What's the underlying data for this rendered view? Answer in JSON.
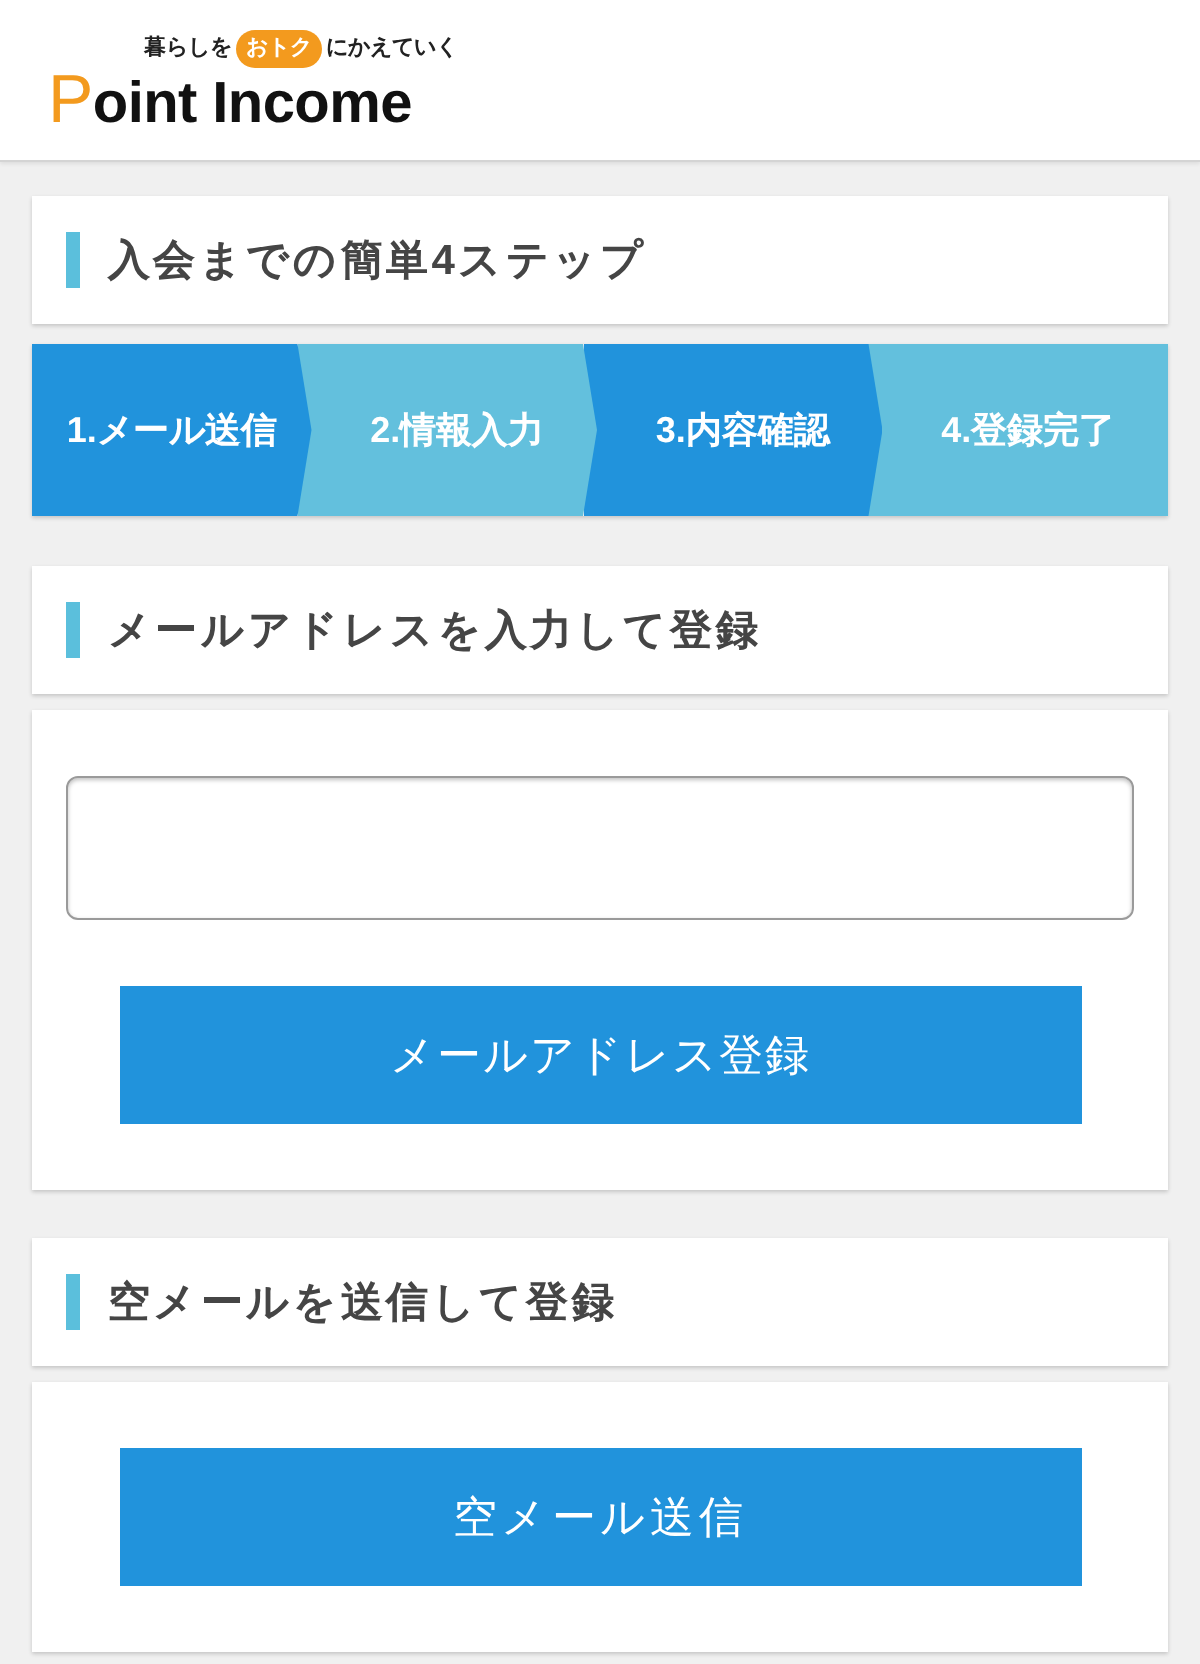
{
  "header": {
    "logo": {
      "tagline_before": "暮らしを",
      "tagline_badge": "おトク",
      "tagline_after": "にかえていく",
      "wordmark_initial": "P",
      "wordmark_rest": "oint Income"
    }
  },
  "steps_section": {
    "title": "入会までの簡単4ステップ",
    "steps": [
      {
        "label": "1.メール送信",
        "color": "#2193dc"
      },
      {
        "label": "2.情報入力",
        "color": "#63c0dd"
      },
      {
        "label": "3.内容確認",
        "color": "#2193dc"
      },
      {
        "label": "4.登録完了",
        "color": "#63c0dd"
      }
    ]
  },
  "email_section": {
    "title": "メールアドレスを入力して登録",
    "button": "メールアドレス登録"
  },
  "empty_mail_section": {
    "title": "空メールを送信して登録",
    "button": "空メール送信"
  }
}
